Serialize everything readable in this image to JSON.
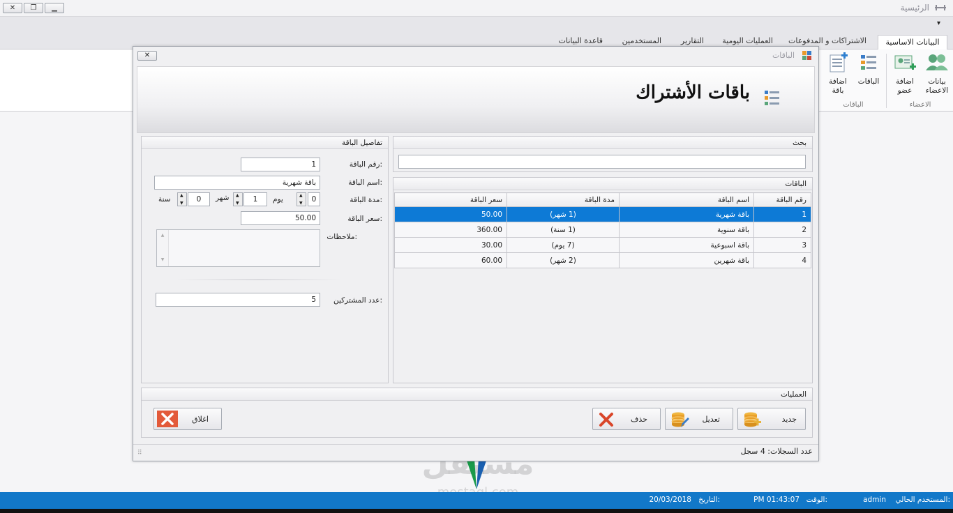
{
  "app": {
    "title": "الرئيسية",
    "minimize": "▁",
    "restore": "❐",
    "close": "✕",
    "quick_access_arrow": "▾"
  },
  "ribbon": {
    "tabs": [
      "البيانات الاساسية",
      "الاشتراكات و المدفوعات",
      "العمليات اليومية",
      "التقارير",
      "المستخدمين",
      "قاعدة البيانات"
    ],
    "buttons": {
      "members_data": "بيانات الاعضاء",
      "add_member": "اضافة عضو",
      "packages": "الباقات",
      "add_package": "اضافة باقة"
    },
    "groups": {
      "members": "الاعضاء",
      "packages": "الباقات"
    }
  },
  "dialog": {
    "title": "الباقات",
    "close": "✕",
    "header_title": "باقات الأشتراك",
    "search_group": "بحث",
    "search_value": "",
    "packages_group": "الباقات",
    "table": {
      "headers": [
        "رقم الباقة",
        "اسم الباقة",
        "مدة الباقة",
        "سعر الباقة"
      ],
      "rows": [
        [
          "1",
          "باقة شهرية",
          "(1 شهر)",
          "50.00"
        ],
        [
          "2",
          "باقة سنوية",
          "(1 سنة)",
          "360.00"
        ],
        [
          "3",
          "باقة اسبوعية",
          "(7 يوم)",
          "30.00"
        ],
        [
          "4",
          "باقة شهرين",
          "(2 شهر)",
          "60.00"
        ]
      ]
    },
    "details": {
      "group": "تفاصيل الباقة",
      "number_label": "رقم الباقة:",
      "number_value": "1",
      "name_label": "اسم الباقة:",
      "name_value": "باقة شهرية",
      "duration_label": "مدة الباقة:",
      "day_value": "0",
      "day_label": "يوم",
      "month_value": "1",
      "month_label": "شهر",
      "year_value": "0",
      "year_label": "سنة",
      "price_label": "سعر الباقة:",
      "price_value": "50.00",
      "notes_label": "ملاحظات:",
      "notes_value": "",
      "subscribers_label": "عدد المشتركين:",
      "subscribers_value": "5"
    },
    "operations": {
      "group": "العمليات",
      "new": "جديد",
      "edit": "تعديل",
      "delete": "حذف",
      "close": "اغلاق"
    },
    "record_count": "عدد السجلات:  4 سجل"
  },
  "status": {
    "user_label": "المستخدم الحالي:",
    "user_value": "admin",
    "time_label": "الوقت:",
    "time_value": "PM 01:43:07",
    "date_label": "التاريخ:",
    "date_value": "20/03/2018"
  },
  "watermark": {
    "text": "مستقل",
    "sub": "mostaql.com"
  },
  "colors": {
    "accent": "#1278c9",
    "selection": "#0d7ad6",
    "close_red": "#e35a3a"
  }
}
